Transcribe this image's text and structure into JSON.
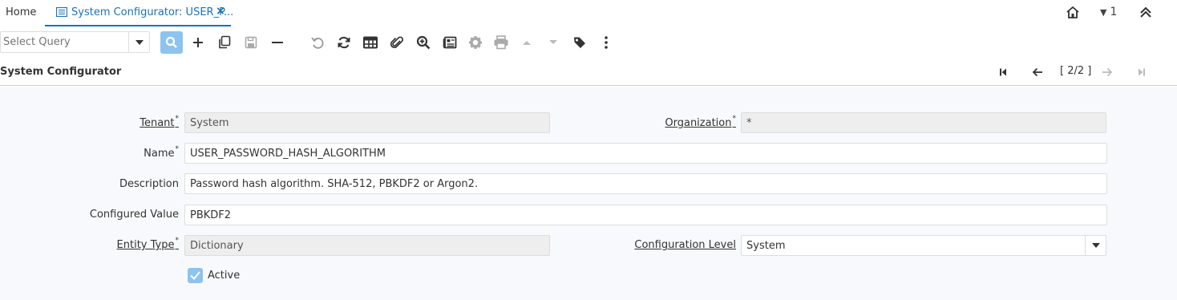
{
  "tabs": {
    "home_label": "Home",
    "active_label": "System Configurator: USER_P...",
    "close_symbol": "×"
  },
  "topbar": {
    "notification_count": "1"
  },
  "toolbar": {
    "query_placeholder": "Select Query",
    "icons": [
      "search-icon",
      "new-icon",
      "copy-icon",
      "save-icon",
      "delete-icon",
      "undo-icon",
      "refresh-icon",
      "grid-toggle-icon",
      "attachment-icon",
      "zoom-across-icon",
      "report-icon",
      "process-gear-icon",
      "print-icon",
      "previous-parent-icon",
      "next-detail-icon",
      "tag-icon",
      "more-icon"
    ]
  },
  "header": {
    "title": "System Configurator",
    "record_position": "[ 2/2 ]"
  },
  "form": {
    "tenant": {
      "label": "Tenant",
      "required": "*",
      "value": "System"
    },
    "organization": {
      "label": "Organization",
      "required": "*",
      "value": "*"
    },
    "name": {
      "label": "Name",
      "required": "*",
      "value": "USER_PASSWORD_HASH_ALGORITHM"
    },
    "description": {
      "label": "Description",
      "value": "Password hash algorithm. SHA-512, PBKDF2 or Argon2."
    },
    "configured_value": {
      "label": "Configured Value",
      "value": "PBKDF2"
    },
    "entity_type": {
      "label": "Entity Type",
      "required": "*",
      "value": "Dictionary"
    },
    "configuration_level": {
      "label": "Configuration Level",
      "value": "System"
    },
    "active": {
      "label": "Active",
      "checked": true
    }
  },
  "colors": {
    "accent": "#1a73b8",
    "button_highlight": "#8cc3ef",
    "form_background": "#f7f9fc",
    "readonly_field": "#eeeeee"
  }
}
